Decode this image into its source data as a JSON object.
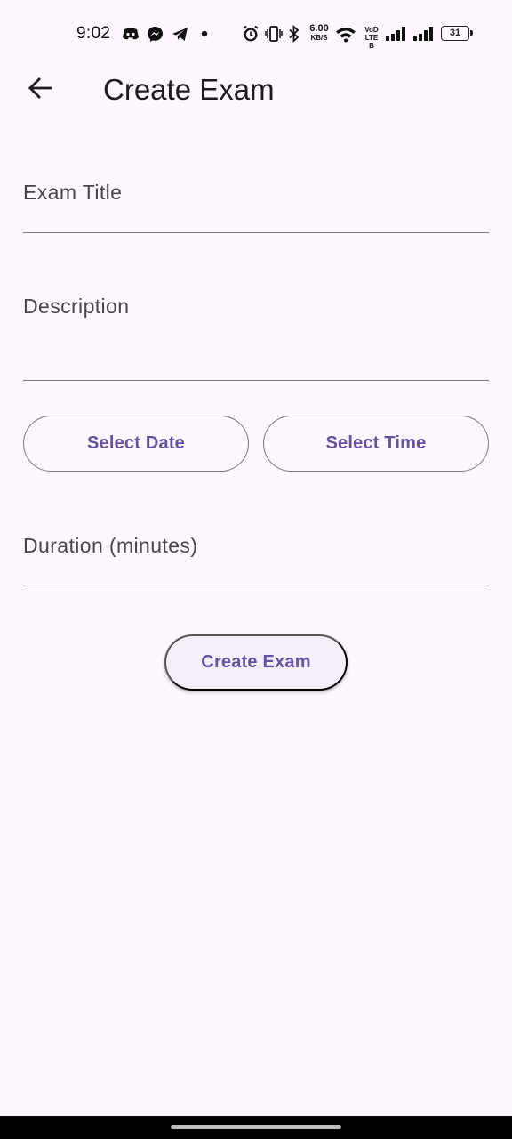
{
  "status_bar": {
    "time": "9:02",
    "net_speed_value": "6.00",
    "net_speed_unit": "KB/S",
    "volte_line1": "VoD",
    "volte_line2": "LTE B",
    "battery_level": "31",
    "icons": [
      "discord-icon",
      "messenger-icon",
      "telegram-icon",
      "dot-icon",
      "alarm-icon",
      "vibrate-icon",
      "bluetooth-icon",
      "wifi-icon",
      "signal-icon",
      "signal-icon",
      "battery-icon"
    ]
  },
  "app_bar": {
    "back_icon": "arrow-back-icon",
    "title": "Create Exam"
  },
  "form": {
    "exam_title_label": "Exam Title",
    "exam_title_value": "",
    "description_label": "Description",
    "description_value": "",
    "select_date_label": "Select Date",
    "select_time_label": "Select Time",
    "duration_label": "Duration (minutes)",
    "duration_value": "",
    "submit_label": "Create Exam"
  },
  "colors": {
    "background": "#fdf7fe",
    "primary": "#6750a4",
    "outline": "#79747e",
    "on_surface": "#1d1b20",
    "on_surface_variant": "#49454f"
  }
}
